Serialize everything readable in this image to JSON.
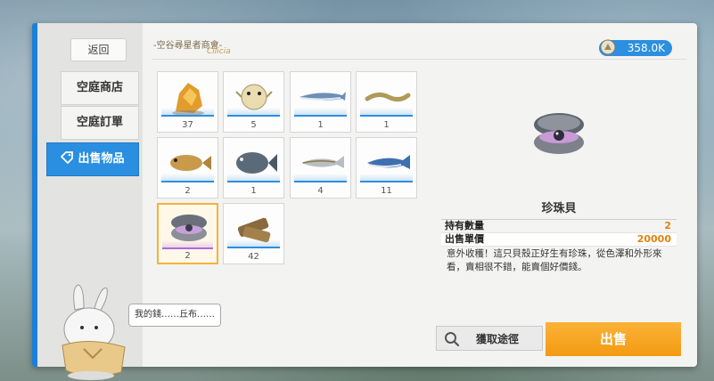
{
  "header": {
    "title": "-空谷尋星者商會-",
    "money": "358.0K"
  },
  "sidebar": {
    "back_label": "返回",
    "items": [
      {
        "label": "空庭商店",
        "active": false
      },
      {
        "label": "空庭訂單",
        "active": false
      },
      {
        "label": "出售物品",
        "active": true
      }
    ]
  },
  "inventory": [
    {
      "name": "golden-ore",
      "count": "37"
    },
    {
      "name": "pufferfish",
      "count": "5"
    },
    {
      "name": "saury",
      "count": "1"
    },
    {
      "name": "eel",
      "count": "1"
    },
    {
      "name": "goby",
      "count": "2"
    },
    {
      "name": "rockfish",
      "count": "1"
    },
    {
      "name": "sardine",
      "count": "4"
    },
    {
      "name": "mackerel",
      "count": "11"
    },
    {
      "name": "pearl-shell",
      "count": "2",
      "selected": true
    },
    {
      "name": "wood-logs",
      "count": "42"
    }
  ],
  "detail": {
    "name": "珍珠貝",
    "owned_label": "持有數量",
    "owned_value": "2",
    "price_label": "出售單價",
    "price_value": "20000",
    "description": "意外收穫！這只貝殼正好生有珍珠，從色澤和外形來看，賣相很不錯，能賣個好價錢。"
  },
  "buttons": {
    "source_label": "獲取途徑",
    "sell_label": "出售"
  },
  "speech": "我的錢……丘布……",
  "colors": {
    "accent": "#2a8fe0",
    "sell": "#f39a12",
    "selected": "#f2b33a"
  }
}
